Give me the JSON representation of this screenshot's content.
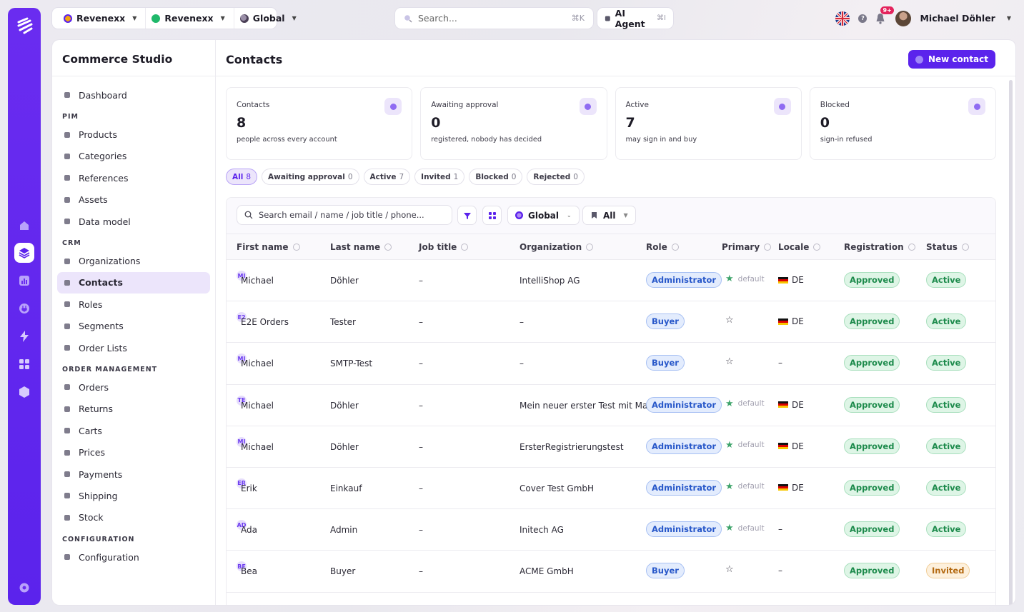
{
  "topbar": {
    "switcher": [
      {
        "label": "Revenexx",
        "color": "#f2a30f"
      },
      {
        "label": "Revenexx",
        "color": "#1fb86a"
      },
      {
        "label": "Global",
        "color": "#5b4b6a"
      }
    ],
    "search_placeholder": "Search...",
    "search_shortcut": "⌘K",
    "ai_agent_label": "AI Agent",
    "ai_agent_shortcut": "⌘I",
    "notifications_badge": "9+",
    "user_name": "Michael Döhler"
  },
  "sidebar": {
    "studio_title": "Commerce Studio",
    "sections": [
      {
        "title": "",
        "items": [
          {
            "label": "Dashboard"
          }
        ]
      },
      {
        "title": "PIM",
        "items": [
          {
            "label": "Products"
          },
          {
            "label": "Categories"
          },
          {
            "label": "References"
          },
          {
            "label": "Assets"
          },
          {
            "label": "Data model"
          }
        ]
      },
      {
        "title": "CRM",
        "items": [
          {
            "label": "Organizations"
          },
          {
            "label": "Contacts",
            "active": true
          },
          {
            "label": "Roles"
          },
          {
            "label": "Segments"
          },
          {
            "label": "Order Lists"
          }
        ]
      },
      {
        "title": "ORDER MANAGEMENT",
        "items": [
          {
            "label": "Orders"
          },
          {
            "label": "Returns"
          },
          {
            "label": "Carts"
          },
          {
            "label": "Prices"
          },
          {
            "label": "Payments"
          },
          {
            "label": "Shipping"
          },
          {
            "label": "Stock"
          }
        ]
      },
      {
        "title": "CONFIGURATION",
        "items": [
          {
            "label": "Configuration"
          }
        ]
      }
    ]
  },
  "page": {
    "title": "Contacts",
    "new_button": "New contact"
  },
  "kpis": [
    {
      "label": "Contacts",
      "value": "8",
      "sub": "people across every account"
    },
    {
      "label": "Awaiting approval",
      "value": "0",
      "sub": "registered, nobody has decided"
    },
    {
      "label": "Active",
      "value": "7",
      "sub": "may sign in and buy"
    },
    {
      "label": "Blocked",
      "value": "0",
      "sub": "sign-in refused"
    }
  ],
  "filters": [
    {
      "label": "All",
      "count": "8",
      "active": true
    },
    {
      "label": "Awaiting approval",
      "count": "0"
    },
    {
      "label": "Active",
      "count": "7"
    },
    {
      "label": "Invited",
      "count": "1"
    },
    {
      "label": "Blocked",
      "count": "0"
    },
    {
      "label": "Rejected",
      "count": "0"
    }
  ],
  "toolbar": {
    "search_placeholder": "Search email / name / job title / phone...",
    "scope_label": "Global",
    "list_label": "All"
  },
  "table": {
    "columns": [
      "First name",
      "Last name",
      "Job title",
      "Organization",
      "Role",
      "Primary",
      "Locale",
      "Registration",
      "Status"
    ],
    "rows": [
      {
        "initials": "MI",
        "first": "Michael",
        "last": "Döhler",
        "job": "–",
        "org": "IntelliShop AG",
        "role": "Administrator",
        "primary": true,
        "primary_label": "default",
        "locale": "DE",
        "registration": "Approved",
        "status": "Active"
      },
      {
        "initials": "E2",
        "first": "E2E Orders",
        "last": "Tester",
        "job": "–",
        "org": "–",
        "role": "Buyer",
        "primary": false,
        "primary_label": "",
        "locale": "DE",
        "registration": "Approved",
        "status": "Active"
      },
      {
        "initials": "MI",
        "first": "Michael",
        "last": "SMTP-Test",
        "job": "–",
        "org": "–",
        "role": "Buyer",
        "primary": false,
        "primary_label": "",
        "locale": "–",
        "registration": "Approved",
        "status": "Active"
      },
      {
        "initials": "TE",
        "first": "Michael",
        "last": "Döhler",
        "job": "–",
        "org": "Mein neuer erster Test mit Mail",
        "role": "Administrator",
        "primary": true,
        "primary_label": "default",
        "locale": "DE",
        "registration": "Approved",
        "status": "Active"
      },
      {
        "initials": "MI",
        "first": "Michael",
        "last": "Döhler",
        "job": "–",
        "org": "ErsterRegistrierungstest",
        "role": "Administrator",
        "primary": true,
        "primary_label": "default",
        "locale": "DE",
        "registration": "Approved",
        "status": "Active"
      },
      {
        "initials": "ER",
        "first": "Erik",
        "last": "Einkauf",
        "job": "–",
        "org": "Cover Test GmbH",
        "role": "Administrator",
        "primary": true,
        "primary_label": "default",
        "locale": "DE",
        "registration": "Approved",
        "status": "Active"
      },
      {
        "initials": "AD",
        "first": "Ada",
        "last": "Admin",
        "job": "–",
        "org": "Initech AG",
        "role": "Administrator",
        "primary": true,
        "primary_label": "default",
        "locale": "–",
        "registration": "Approved",
        "status": "Active"
      },
      {
        "initials": "BE",
        "first": "Bea",
        "last": "Buyer",
        "job": "–",
        "org": "ACME GmbH",
        "role": "Buyer",
        "primary": false,
        "primary_label": "",
        "locale": "–",
        "registration": "Approved",
        "status": "Invited"
      }
    ]
  },
  "colors": {
    "accent": "#5b23ec",
    "approved": "#1c8a4b",
    "invited": "#b46a12",
    "role": "#2757c9"
  }
}
